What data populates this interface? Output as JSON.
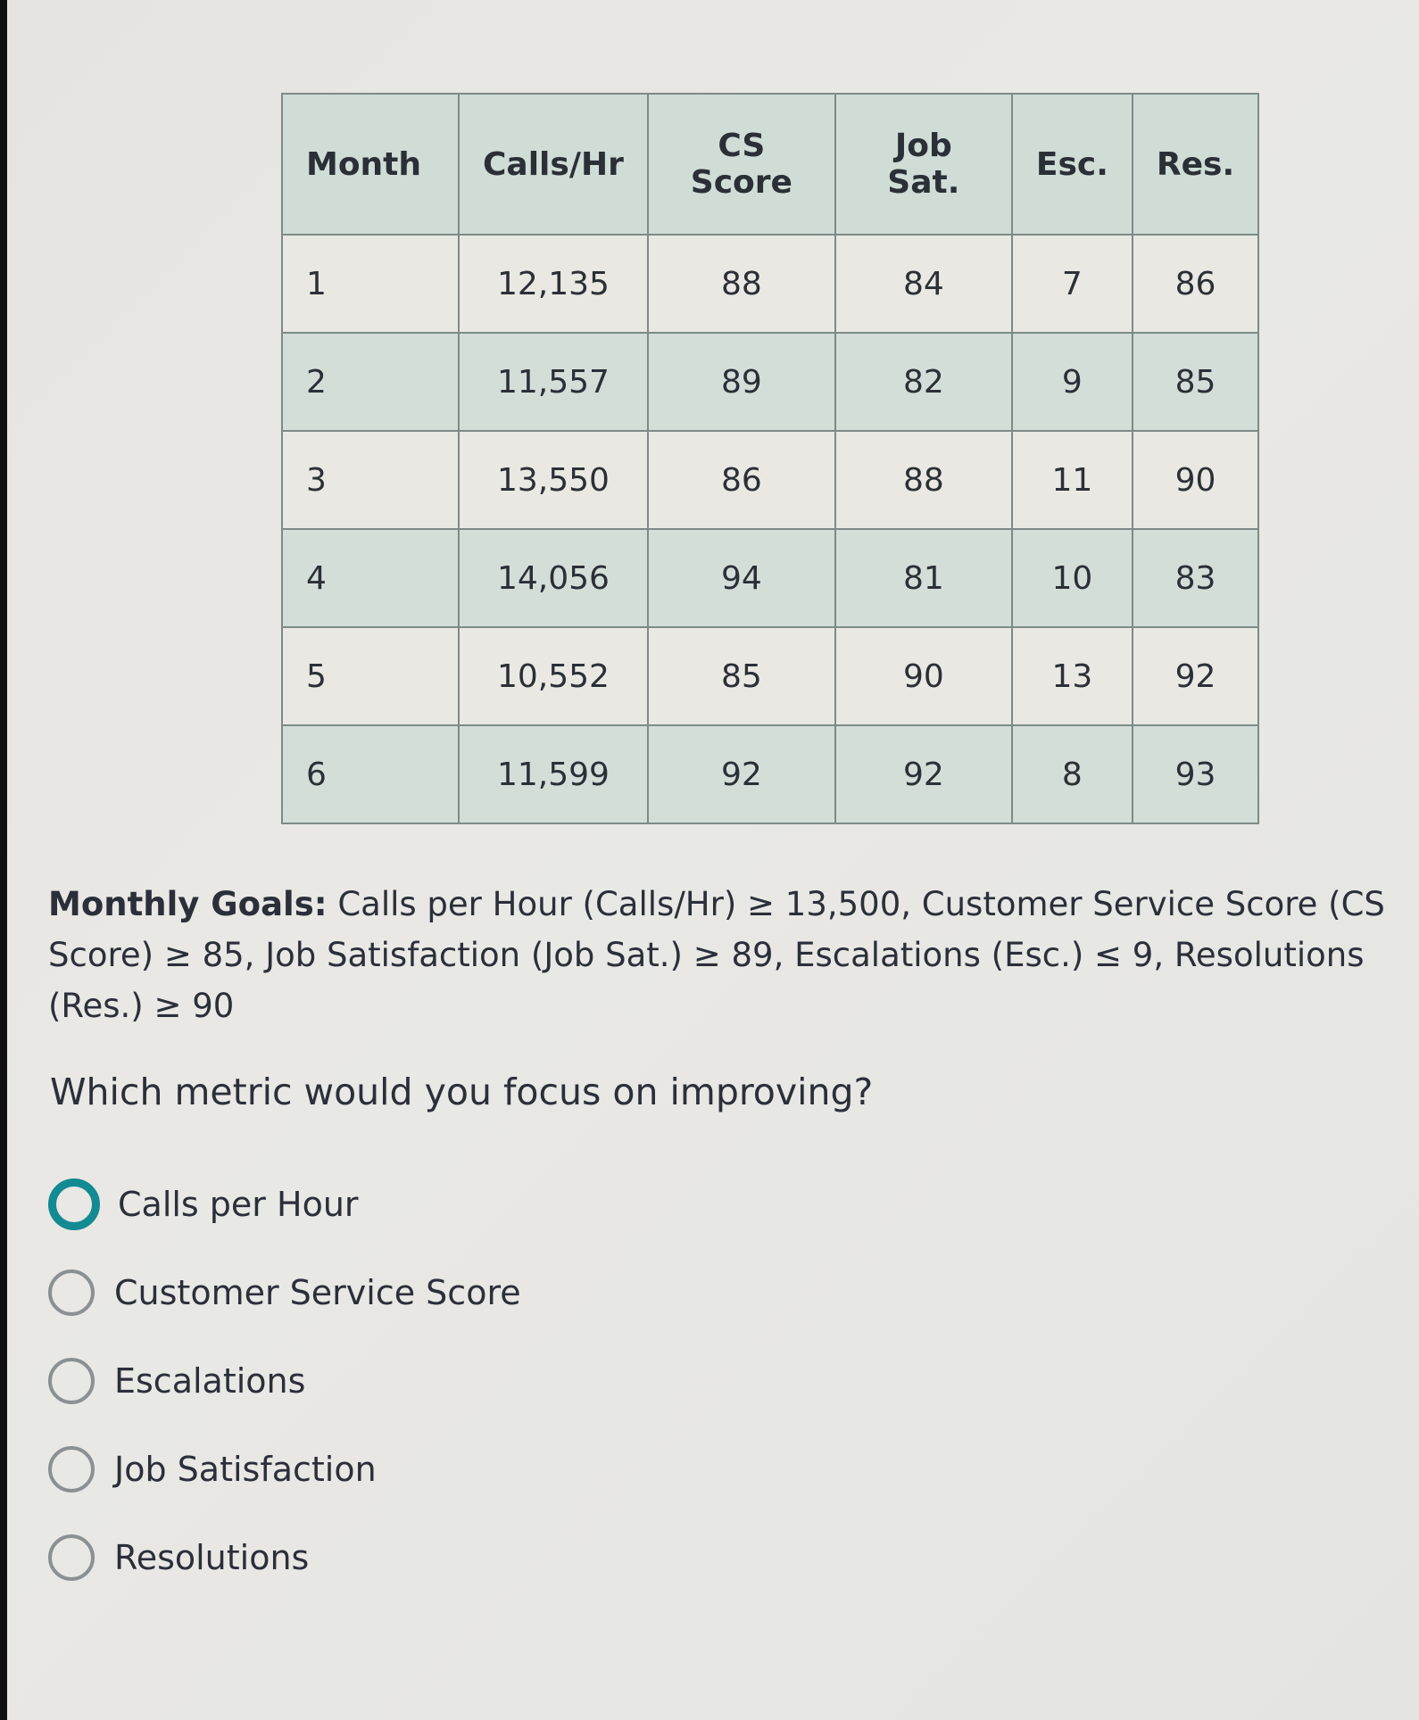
{
  "table": {
    "headers": [
      "Month",
      "Calls/Hr",
      "CS Score",
      "Job Sat.",
      "Esc.",
      "Res."
    ],
    "rows": [
      [
        "1",
        "12,135",
        "88",
        "84",
        "7",
        "86"
      ],
      [
        "2",
        "11,557",
        "89",
        "82",
        "9",
        "85"
      ],
      [
        "3",
        "13,550",
        "86",
        "88",
        "11",
        "90"
      ],
      [
        "4",
        "14,056",
        "94",
        "81",
        "10",
        "83"
      ],
      [
        "5",
        "10,552",
        "85",
        "90",
        "13",
        "92"
      ],
      [
        "6",
        "11,599",
        "92",
        "92",
        "8",
        "93"
      ]
    ]
  },
  "goals": {
    "label": "Monthly Goals:",
    "text": " Calls per Hour (Calls/Hr) ≥ 13,500, Customer Service Score (CS Score) ≥ 85, Job Satisfaction (Job Sat.) ≥ 89, Escalations (Esc.) ≤ 9, Resolutions (Res.) ≥ 90"
  },
  "question": "Which metric would you focus on improving?",
  "options": [
    {
      "label": "Calls per Hour",
      "focused": true,
      "selected": false
    },
    {
      "label": "Customer Service Score",
      "focused": false,
      "selected": false
    },
    {
      "label": "Escalations",
      "focused": false,
      "selected": false
    },
    {
      "label": "Job Satisfaction",
      "focused": false,
      "selected": false
    },
    {
      "label": "Resolutions",
      "focused": false,
      "selected": false
    }
  ],
  "colors": {
    "header_bg": "#cfddd6",
    "alt_row_bg": "#d3ded8",
    "focus_ring": "#148a93",
    "radio_border": "#8a9093"
  }
}
